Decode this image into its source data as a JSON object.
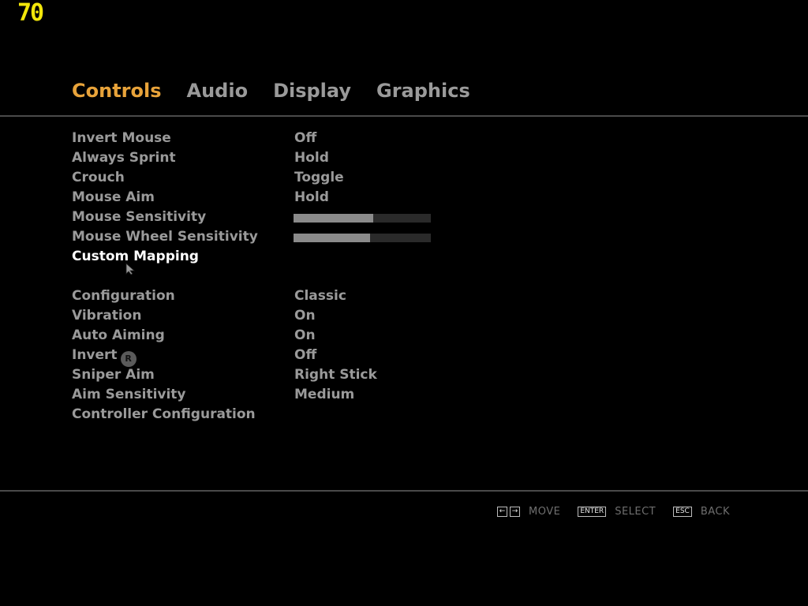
{
  "hud": {
    "fps": "70"
  },
  "tabs": [
    {
      "label": "Controls",
      "active": true
    },
    {
      "label": "Audio",
      "active": false
    },
    {
      "label": "Display",
      "active": false
    },
    {
      "label": "Graphics",
      "active": false
    }
  ],
  "mouse_settings": {
    "invert_mouse": {
      "label": "Invert Mouse",
      "value": "Off"
    },
    "always_sprint": {
      "label": "Always Sprint",
      "value": "Hold"
    },
    "crouch": {
      "label": "Crouch",
      "value": "Toggle"
    },
    "mouse_aim": {
      "label": "Mouse Aim",
      "value": "Hold"
    },
    "mouse_sensitivity": {
      "label": "Mouse Sensitivity",
      "level": 0.58
    },
    "mouse_wheel_sensitivity": {
      "label": "Mouse Wheel Sensitivity",
      "level": 0.56
    },
    "custom_mapping": {
      "label": "Custom Mapping"
    }
  },
  "controller_settings": {
    "configuration": {
      "label": "Configuration",
      "value": "Classic"
    },
    "vibration": {
      "label": "Vibration",
      "value": "On"
    },
    "auto_aiming": {
      "label": "Auto Aiming",
      "value": "On"
    },
    "invert_stick": {
      "label": "Invert",
      "icon": "right-stick-icon",
      "icon_glyph": "R",
      "value": "Off"
    },
    "sniper_aim": {
      "label": "Sniper Aim",
      "value": "Right Stick"
    },
    "aim_sensitivity": {
      "label": "Aim Sensitivity",
      "value": "Medium"
    },
    "controller_configuration": {
      "label": "Controller Configuration"
    }
  },
  "footer": {
    "move": {
      "keys": [
        "←",
        "→"
      ],
      "label": "MOVE"
    },
    "select": {
      "key": "ENTER",
      "label": "SELECT"
    },
    "back": {
      "key": "ESC",
      "label": "BACK"
    }
  },
  "colors": {
    "active_tab": "#e8a33a",
    "inactive_text": "#9a9a9a",
    "selected_text": "#ffffff",
    "fps_counter": "#f2e60a",
    "background": "#000000"
  }
}
